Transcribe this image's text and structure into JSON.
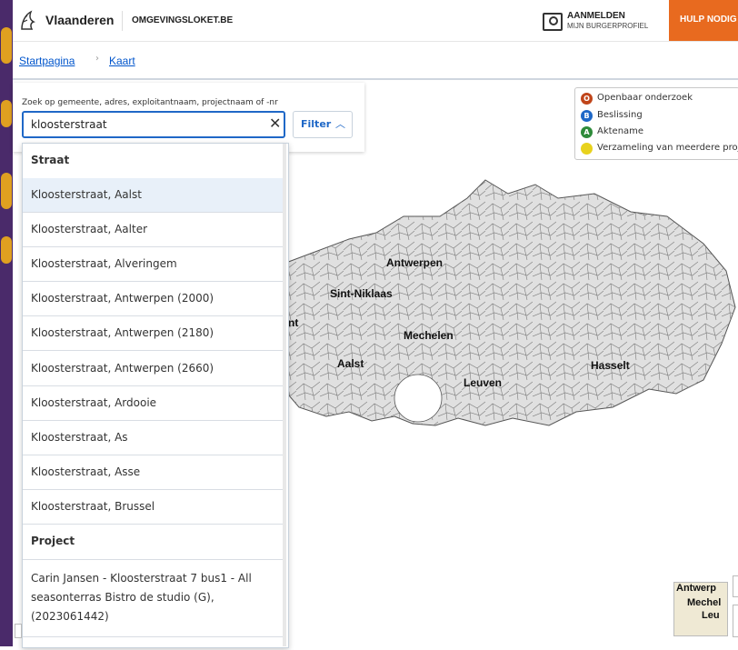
{
  "header": {
    "brand": "Vlaanderen",
    "site": "OMGEVINGSLOKET.BE",
    "login_line1": "AANMELDEN",
    "login_line2": "MIJN BURGERPROFIEL",
    "help_label": "HULP NODIG"
  },
  "breadcrumb": {
    "home": "Startpagina",
    "current": "Kaart"
  },
  "search": {
    "label": "Zoek op gemeente, adres, exploitantnaam, projectnaam of -nr",
    "value": "kloosterstraat",
    "filter_label": "Filter"
  },
  "dropdown": {
    "street_heading": "Straat",
    "streets": [
      "Kloosterstraat, Aalst",
      "Kloosterstraat, Aalter",
      "Kloosterstraat, Alveringem",
      "Kloosterstraat, Antwerpen (2000)",
      "Kloosterstraat, Antwerpen (2180)",
      "Kloosterstraat, Antwerpen (2660)",
      "Kloosterstraat, Ardooie",
      "Kloosterstraat, As",
      "Kloosterstraat, Asse",
      "Kloosterstraat, Brussel"
    ],
    "project_heading": "Project",
    "project_item": "Carin Jansen - Kloosterstraat 7 bus1 - All seasonterras Bistro de studio (G), (2023061442)"
  },
  "legend": {
    "items": [
      {
        "badge": "O",
        "label": "Openbaar onderzoek",
        "color": "#c0451a"
      },
      {
        "badge": "B",
        "label": "Beslissing",
        "color": "#1f68c7"
      },
      {
        "badge": "A",
        "label": "Aktename",
        "color": "#2e8b3a"
      },
      {
        "badge": "",
        "label": "Verzameling van meerdere proje",
        "color": "#e8d21d"
      }
    ]
  },
  "map": {
    "cities": [
      "Antwerpen",
      "Sint-Niklaas",
      "nt",
      "Mechelen",
      "Aalst",
      "Leuven",
      "Hasselt"
    ],
    "thumb_labels": [
      "Antwerp",
      "Mechel",
      "Leu"
    ]
  }
}
